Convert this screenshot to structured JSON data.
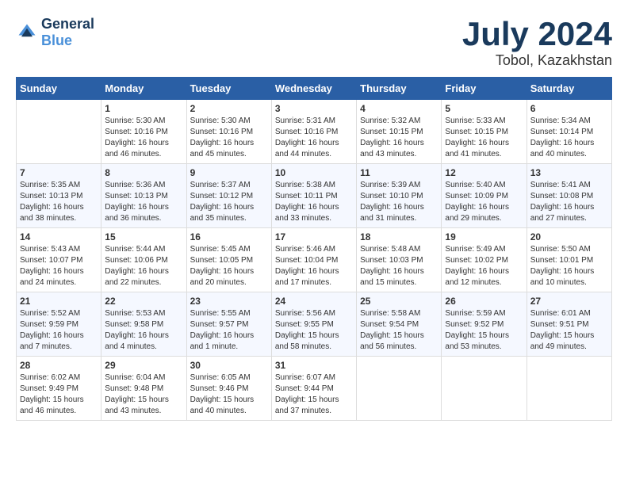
{
  "header": {
    "logo_line1": "General",
    "logo_line2": "Blue",
    "month": "July 2024",
    "location": "Tobol, Kazakhstan"
  },
  "weekdays": [
    "Sunday",
    "Monday",
    "Tuesday",
    "Wednesday",
    "Thursday",
    "Friday",
    "Saturday"
  ],
  "weeks": [
    [
      {
        "day": "",
        "sunrise": "",
        "sunset": "",
        "daylight": ""
      },
      {
        "day": "1",
        "sunrise": "Sunrise: 5:30 AM",
        "sunset": "Sunset: 10:16 PM",
        "daylight": "Daylight: 16 hours and 46 minutes."
      },
      {
        "day": "2",
        "sunrise": "Sunrise: 5:30 AM",
        "sunset": "Sunset: 10:16 PM",
        "daylight": "Daylight: 16 hours and 45 minutes."
      },
      {
        "day": "3",
        "sunrise": "Sunrise: 5:31 AM",
        "sunset": "Sunset: 10:16 PM",
        "daylight": "Daylight: 16 hours and 44 minutes."
      },
      {
        "day": "4",
        "sunrise": "Sunrise: 5:32 AM",
        "sunset": "Sunset: 10:15 PM",
        "daylight": "Daylight: 16 hours and 43 minutes."
      },
      {
        "day": "5",
        "sunrise": "Sunrise: 5:33 AM",
        "sunset": "Sunset: 10:15 PM",
        "daylight": "Daylight: 16 hours and 41 minutes."
      },
      {
        "day": "6",
        "sunrise": "Sunrise: 5:34 AM",
        "sunset": "Sunset: 10:14 PM",
        "daylight": "Daylight: 16 hours and 40 minutes."
      }
    ],
    [
      {
        "day": "7",
        "sunrise": "Sunrise: 5:35 AM",
        "sunset": "Sunset: 10:13 PM",
        "daylight": "Daylight: 16 hours and 38 minutes."
      },
      {
        "day": "8",
        "sunrise": "Sunrise: 5:36 AM",
        "sunset": "Sunset: 10:13 PM",
        "daylight": "Daylight: 16 hours and 36 minutes."
      },
      {
        "day": "9",
        "sunrise": "Sunrise: 5:37 AM",
        "sunset": "Sunset: 10:12 PM",
        "daylight": "Daylight: 16 hours and 35 minutes."
      },
      {
        "day": "10",
        "sunrise": "Sunrise: 5:38 AM",
        "sunset": "Sunset: 10:11 PM",
        "daylight": "Daylight: 16 hours and 33 minutes."
      },
      {
        "day": "11",
        "sunrise": "Sunrise: 5:39 AM",
        "sunset": "Sunset: 10:10 PM",
        "daylight": "Daylight: 16 hours and 31 minutes."
      },
      {
        "day": "12",
        "sunrise": "Sunrise: 5:40 AM",
        "sunset": "Sunset: 10:09 PM",
        "daylight": "Daylight: 16 hours and 29 minutes."
      },
      {
        "day": "13",
        "sunrise": "Sunrise: 5:41 AM",
        "sunset": "Sunset: 10:08 PM",
        "daylight": "Daylight: 16 hours and 27 minutes."
      }
    ],
    [
      {
        "day": "14",
        "sunrise": "Sunrise: 5:43 AM",
        "sunset": "Sunset: 10:07 PM",
        "daylight": "Daylight: 16 hours and 24 minutes."
      },
      {
        "day": "15",
        "sunrise": "Sunrise: 5:44 AM",
        "sunset": "Sunset: 10:06 PM",
        "daylight": "Daylight: 16 hours and 22 minutes."
      },
      {
        "day": "16",
        "sunrise": "Sunrise: 5:45 AM",
        "sunset": "Sunset: 10:05 PM",
        "daylight": "Daylight: 16 hours and 20 minutes."
      },
      {
        "day": "17",
        "sunrise": "Sunrise: 5:46 AM",
        "sunset": "Sunset: 10:04 PM",
        "daylight": "Daylight: 16 hours and 17 minutes."
      },
      {
        "day": "18",
        "sunrise": "Sunrise: 5:48 AM",
        "sunset": "Sunset: 10:03 PM",
        "daylight": "Daylight: 16 hours and 15 minutes."
      },
      {
        "day": "19",
        "sunrise": "Sunrise: 5:49 AM",
        "sunset": "Sunset: 10:02 PM",
        "daylight": "Daylight: 16 hours and 12 minutes."
      },
      {
        "day": "20",
        "sunrise": "Sunrise: 5:50 AM",
        "sunset": "Sunset: 10:01 PM",
        "daylight": "Daylight: 16 hours and 10 minutes."
      }
    ],
    [
      {
        "day": "21",
        "sunrise": "Sunrise: 5:52 AM",
        "sunset": "Sunset: 9:59 PM",
        "daylight": "Daylight: 16 hours and 7 minutes."
      },
      {
        "day": "22",
        "sunrise": "Sunrise: 5:53 AM",
        "sunset": "Sunset: 9:58 PM",
        "daylight": "Daylight: 16 hours and 4 minutes."
      },
      {
        "day": "23",
        "sunrise": "Sunrise: 5:55 AM",
        "sunset": "Sunset: 9:57 PM",
        "daylight": "Daylight: 16 hours and 1 minute."
      },
      {
        "day": "24",
        "sunrise": "Sunrise: 5:56 AM",
        "sunset": "Sunset: 9:55 PM",
        "daylight": "Daylight: 15 hours and 58 minutes."
      },
      {
        "day": "25",
        "sunrise": "Sunrise: 5:58 AM",
        "sunset": "Sunset: 9:54 PM",
        "daylight": "Daylight: 15 hours and 56 minutes."
      },
      {
        "day": "26",
        "sunrise": "Sunrise: 5:59 AM",
        "sunset": "Sunset: 9:52 PM",
        "daylight": "Daylight: 15 hours and 53 minutes."
      },
      {
        "day": "27",
        "sunrise": "Sunrise: 6:01 AM",
        "sunset": "Sunset: 9:51 PM",
        "daylight": "Daylight: 15 hours and 49 minutes."
      }
    ],
    [
      {
        "day": "28",
        "sunrise": "Sunrise: 6:02 AM",
        "sunset": "Sunset: 9:49 PM",
        "daylight": "Daylight: 15 hours and 46 minutes."
      },
      {
        "day": "29",
        "sunrise": "Sunrise: 6:04 AM",
        "sunset": "Sunset: 9:48 PM",
        "daylight": "Daylight: 15 hours and 43 minutes."
      },
      {
        "day": "30",
        "sunrise": "Sunrise: 6:05 AM",
        "sunset": "Sunset: 9:46 PM",
        "daylight": "Daylight: 15 hours and 40 minutes."
      },
      {
        "day": "31",
        "sunrise": "Sunrise: 6:07 AM",
        "sunset": "Sunset: 9:44 PM",
        "daylight": "Daylight: 15 hours and 37 minutes."
      },
      {
        "day": "",
        "sunrise": "",
        "sunset": "",
        "daylight": ""
      },
      {
        "day": "",
        "sunrise": "",
        "sunset": "",
        "daylight": ""
      },
      {
        "day": "",
        "sunrise": "",
        "sunset": "",
        "daylight": ""
      }
    ]
  ]
}
